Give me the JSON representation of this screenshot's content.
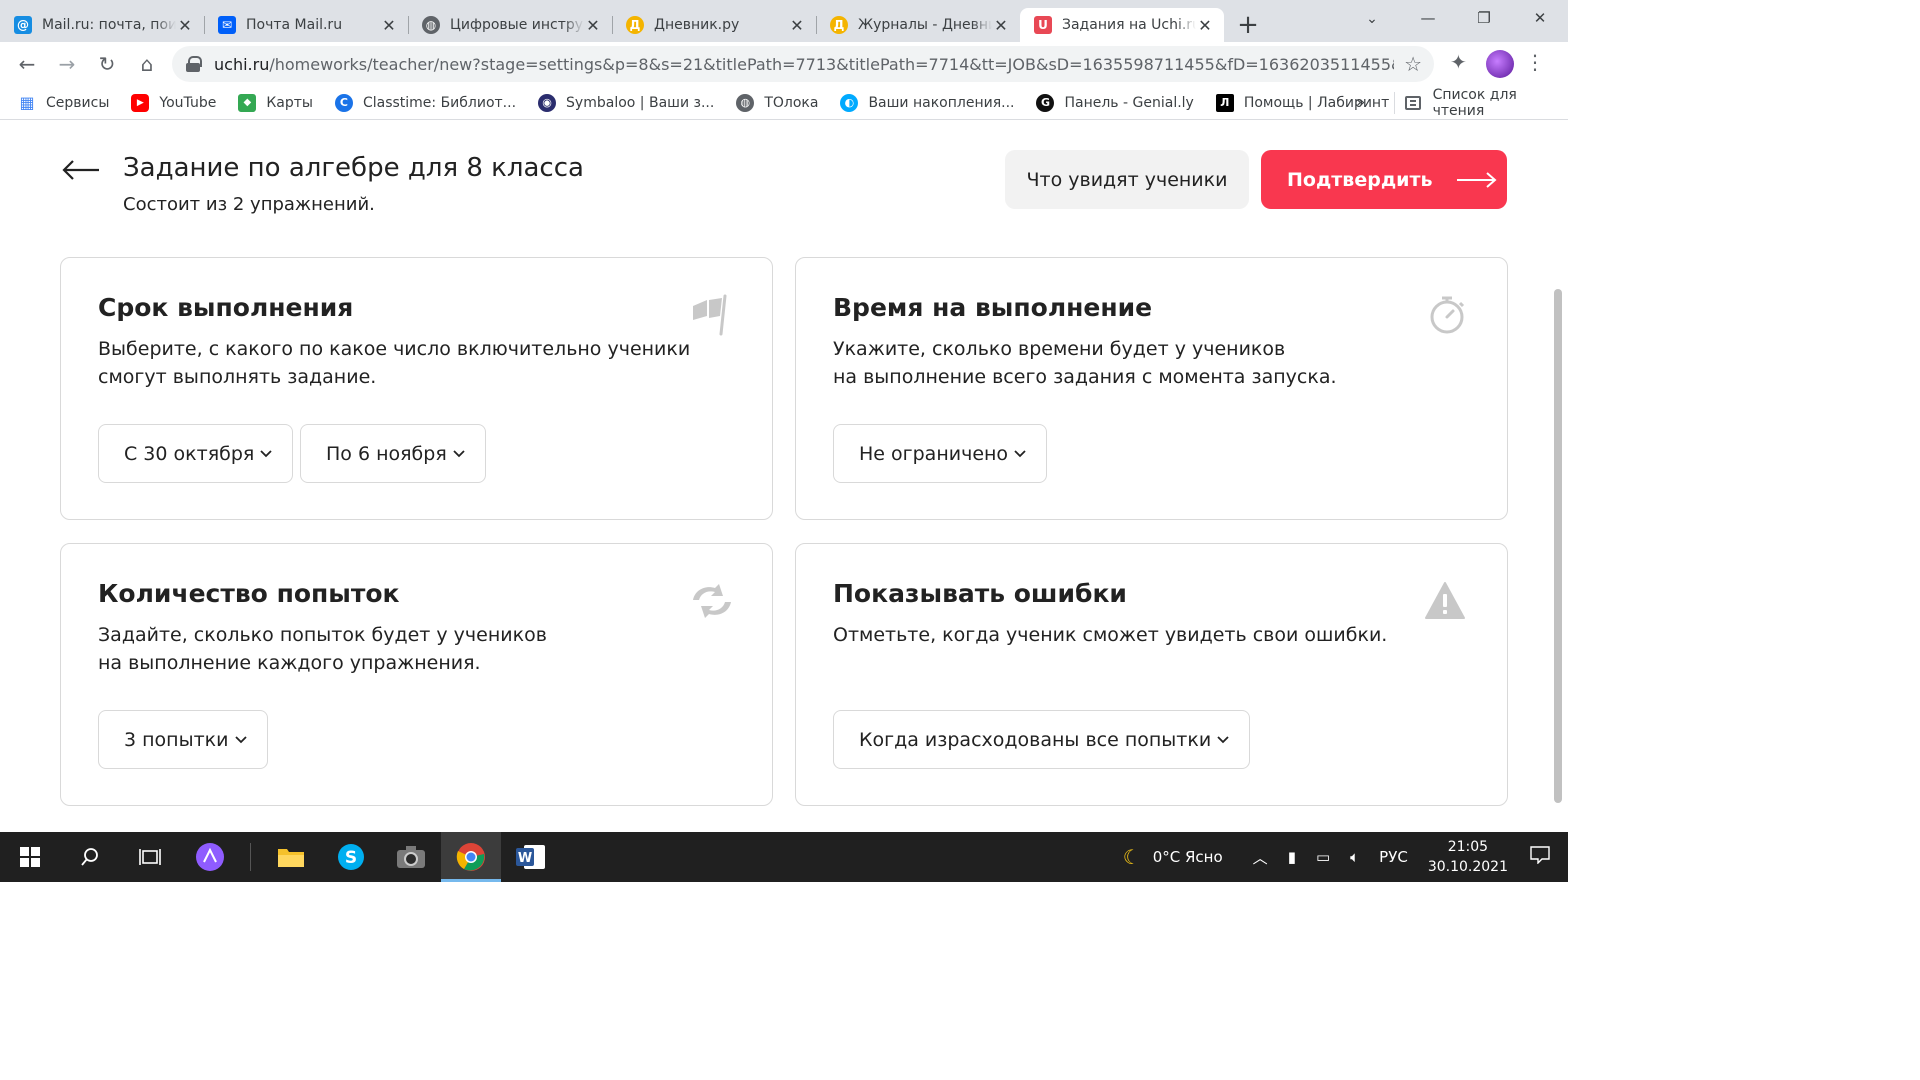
{
  "browser": {
    "tabs": [
      {
        "title": "Mail.ru: почта, поиск в интернете, новости, игры",
        "favicon": "mailru-at-icon",
        "color": "#168de2",
        "glyph": "@",
        "active": false
      },
      {
        "title": "Почта Mail.ru",
        "favicon": "mail-envelope-icon",
        "color": "#005ff9",
        "glyph": "✉",
        "active": false
      },
      {
        "title": "Цифровые инструменты",
        "favicon": "globe-icon",
        "color": "#5f6368",
        "glyph": "◍",
        "active": false
      },
      {
        "title": "Дневник.ру",
        "favicon": "dnevnik-icon",
        "color": "#f4b400",
        "glyph": "Д",
        "active": false
      },
      {
        "title": "Журналы - Дневник.ру",
        "favicon": "dnevnik-icon",
        "color": "#f4b400",
        "glyph": "Д",
        "active": false
      },
      {
        "title": "Задания на Uchi.ru",
        "favicon": "uchi-icon",
        "color": "#e84855",
        "glyph": "U",
        "active": true
      }
    ],
    "new_tab_glyph": "+",
    "window_controls": {
      "minimize": "—",
      "restore": "❐",
      "close": "✕"
    },
    "address": {
      "host": "uchi.ru",
      "path": "/homeworks/teacher/new?stage=settings&p=8&s=21&titlePath=7713&titlePath=7714&tt=JOB&sD=1635598711455&fD=1636203511455&tL=0..."
    },
    "bookmarks": [
      {
        "label": "Сервисы",
        "color": "#4285f4",
        "glyph": "▦"
      },
      {
        "label": "YouTube",
        "color": "#ff0000",
        "glyph": "▶"
      },
      {
        "label": "Карты",
        "color": "#34a853",
        "glyph": "◆"
      },
      {
        "label": "Classtime: Библиот...",
        "color": "#1a73e8",
        "glyph": "C"
      },
      {
        "label": "Symbaloo | Ваши з...",
        "color": "#2b2d6e",
        "glyph": "◉"
      },
      {
        "label": "ТОлока",
        "color": "#5f6368",
        "glyph": "◍"
      },
      {
        "label": "Ваши накопления...",
        "color": "#00aaff",
        "glyph": "◐"
      },
      {
        "label": "Панель - Genial.ly",
        "color": "#111111",
        "glyph": "G"
      },
      {
        "label": "Помощь | Лабиринт",
        "color": "#000000",
        "glyph": "Л"
      }
    ],
    "bookmarks_more": "»",
    "reading_list": "Список для чтения"
  },
  "page": {
    "title": "Задание по алгебре для 8 класса",
    "subtitle": "Состоит из 2 упражнений.",
    "preview_button": "Что увидят ученики",
    "confirm_button": "Подтвердить",
    "accent_color": "#f9374f",
    "cards": {
      "deadline": {
        "title": "Срок выполнения",
        "desc_line1": "Выберите, с какого по какое число включительно ученики",
        "desc_line2": "смогут выполнять задание.",
        "from": "С 30 октября",
        "to": "По 6 ноября",
        "icon": "flag-icon"
      },
      "time_limit": {
        "title": "Время на выполнение",
        "desc_line1": "Укажите, сколько времени будет у учеников",
        "desc_line2": "на выполнение всего задания с момента запуска.",
        "value": "Не ограничено",
        "icon": "stopwatch-icon"
      },
      "attempts": {
        "title": "Количество попыток",
        "desc_line1": "Задайте, сколько попыток будет у учеников",
        "desc_line2": "на выполнение каждого упражнения.",
        "value": "3 попытки",
        "icon": "retry-arrows-icon"
      },
      "show_errors": {
        "title": "Показывать ошибки",
        "desc_line1": "Отметьте, когда ученик сможет увидеть свои ошибки.",
        "value": "Когда израсходованы все попытки",
        "icon": "warning-icon"
      }
    }
  },
  "taskbar": {
    "weather": "0°C  Ясно",
    "language": "РУС",
    "time": "21:05",
    "date": "30.10.2021"
  }
}
